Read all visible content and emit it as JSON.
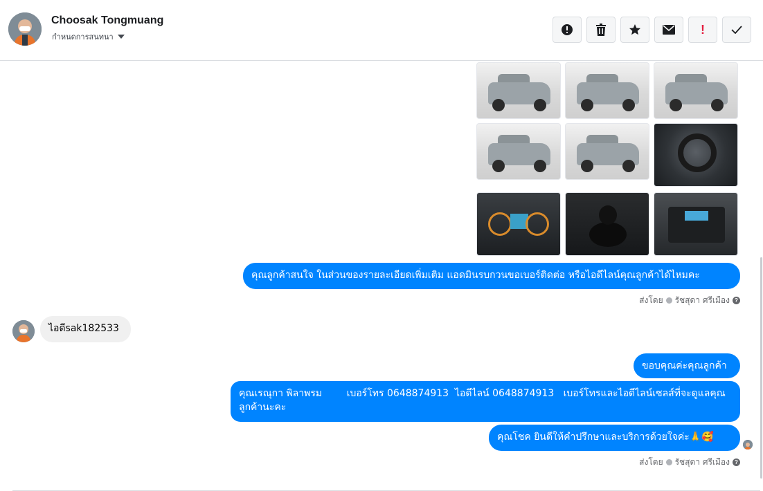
{
  "header": {
    "contact_name": "Choosak Tongmuang",
    "label_dropdown": "กำหนดการสนทนา",
    "actions": [
      {
        "name": "report",
        "icon": "exclamation-circle-icon"
      },
      {
        "name": "delete",
        "icon": "trash-icon"
      },
      {
        "name": "star",
        "icon": "star-icon"
      },
      {
        "name": "mark-unread",
        "icon": "envelope-icon"
      },
      {
        "name": "flag",
        "icon": "red-exclamation-icon",
        "text": "!"
      },
      {
        "name": "done",
        "icon": "checkmark-icon"
      }
    ]
  },
  "photos": [
    {
      "kind": "car-rear-left"
    },
    {
      "kind": "car-rear"
    },
    {
      "kind": "car-side-right"
    },
    {
      "kind": "car-side-left"
    },
    {
      "kind": "car-rear-right"
    },
    {
      "kind": "steering-wheel"
    },
    {
      "kind": "instrument-cluster"
    },
    {
      "kind": "gear-stick"
    },
    {
      "kind": "radio-console"
    }
  ],
  "messages": {
    "m1": "คุณลูกค้าสนใจ ในส่วนของรายละเอียดเพิ่มเติม แอดมินรบกวนขอเบอร์ติดต่อ หรือไอดีไลน์คุณลูกค้าได้ไหมคะ",
    "m1_sent_by_prefix": "ส่งโดย",
    "m1_sender": "รัชสุดา ศรีเมือง",
    "incoming": "ไอดีsak182533",
    "m2": "ขอบคุณค่ะคุณลูกค้า",
    "m3": "คุณเรณุกา พิลาพรม        เบอร์โทร 0648874913  ไอดีไลน์ 0648874913   เบอร์โทรและไอดีไลน์เซลส์ที่จะดูแลคุณลูกค้านะคะ",
    "m4": "คุณโชค ยินดีให้คำปรึกษาและบริการด้วยใจค่ะ🙏🥰",
    "m4_sent_by_prefix": "ส่งโดย",
    "m4_sender": "รัชสุดา ศรีเมือง"
  }
}
